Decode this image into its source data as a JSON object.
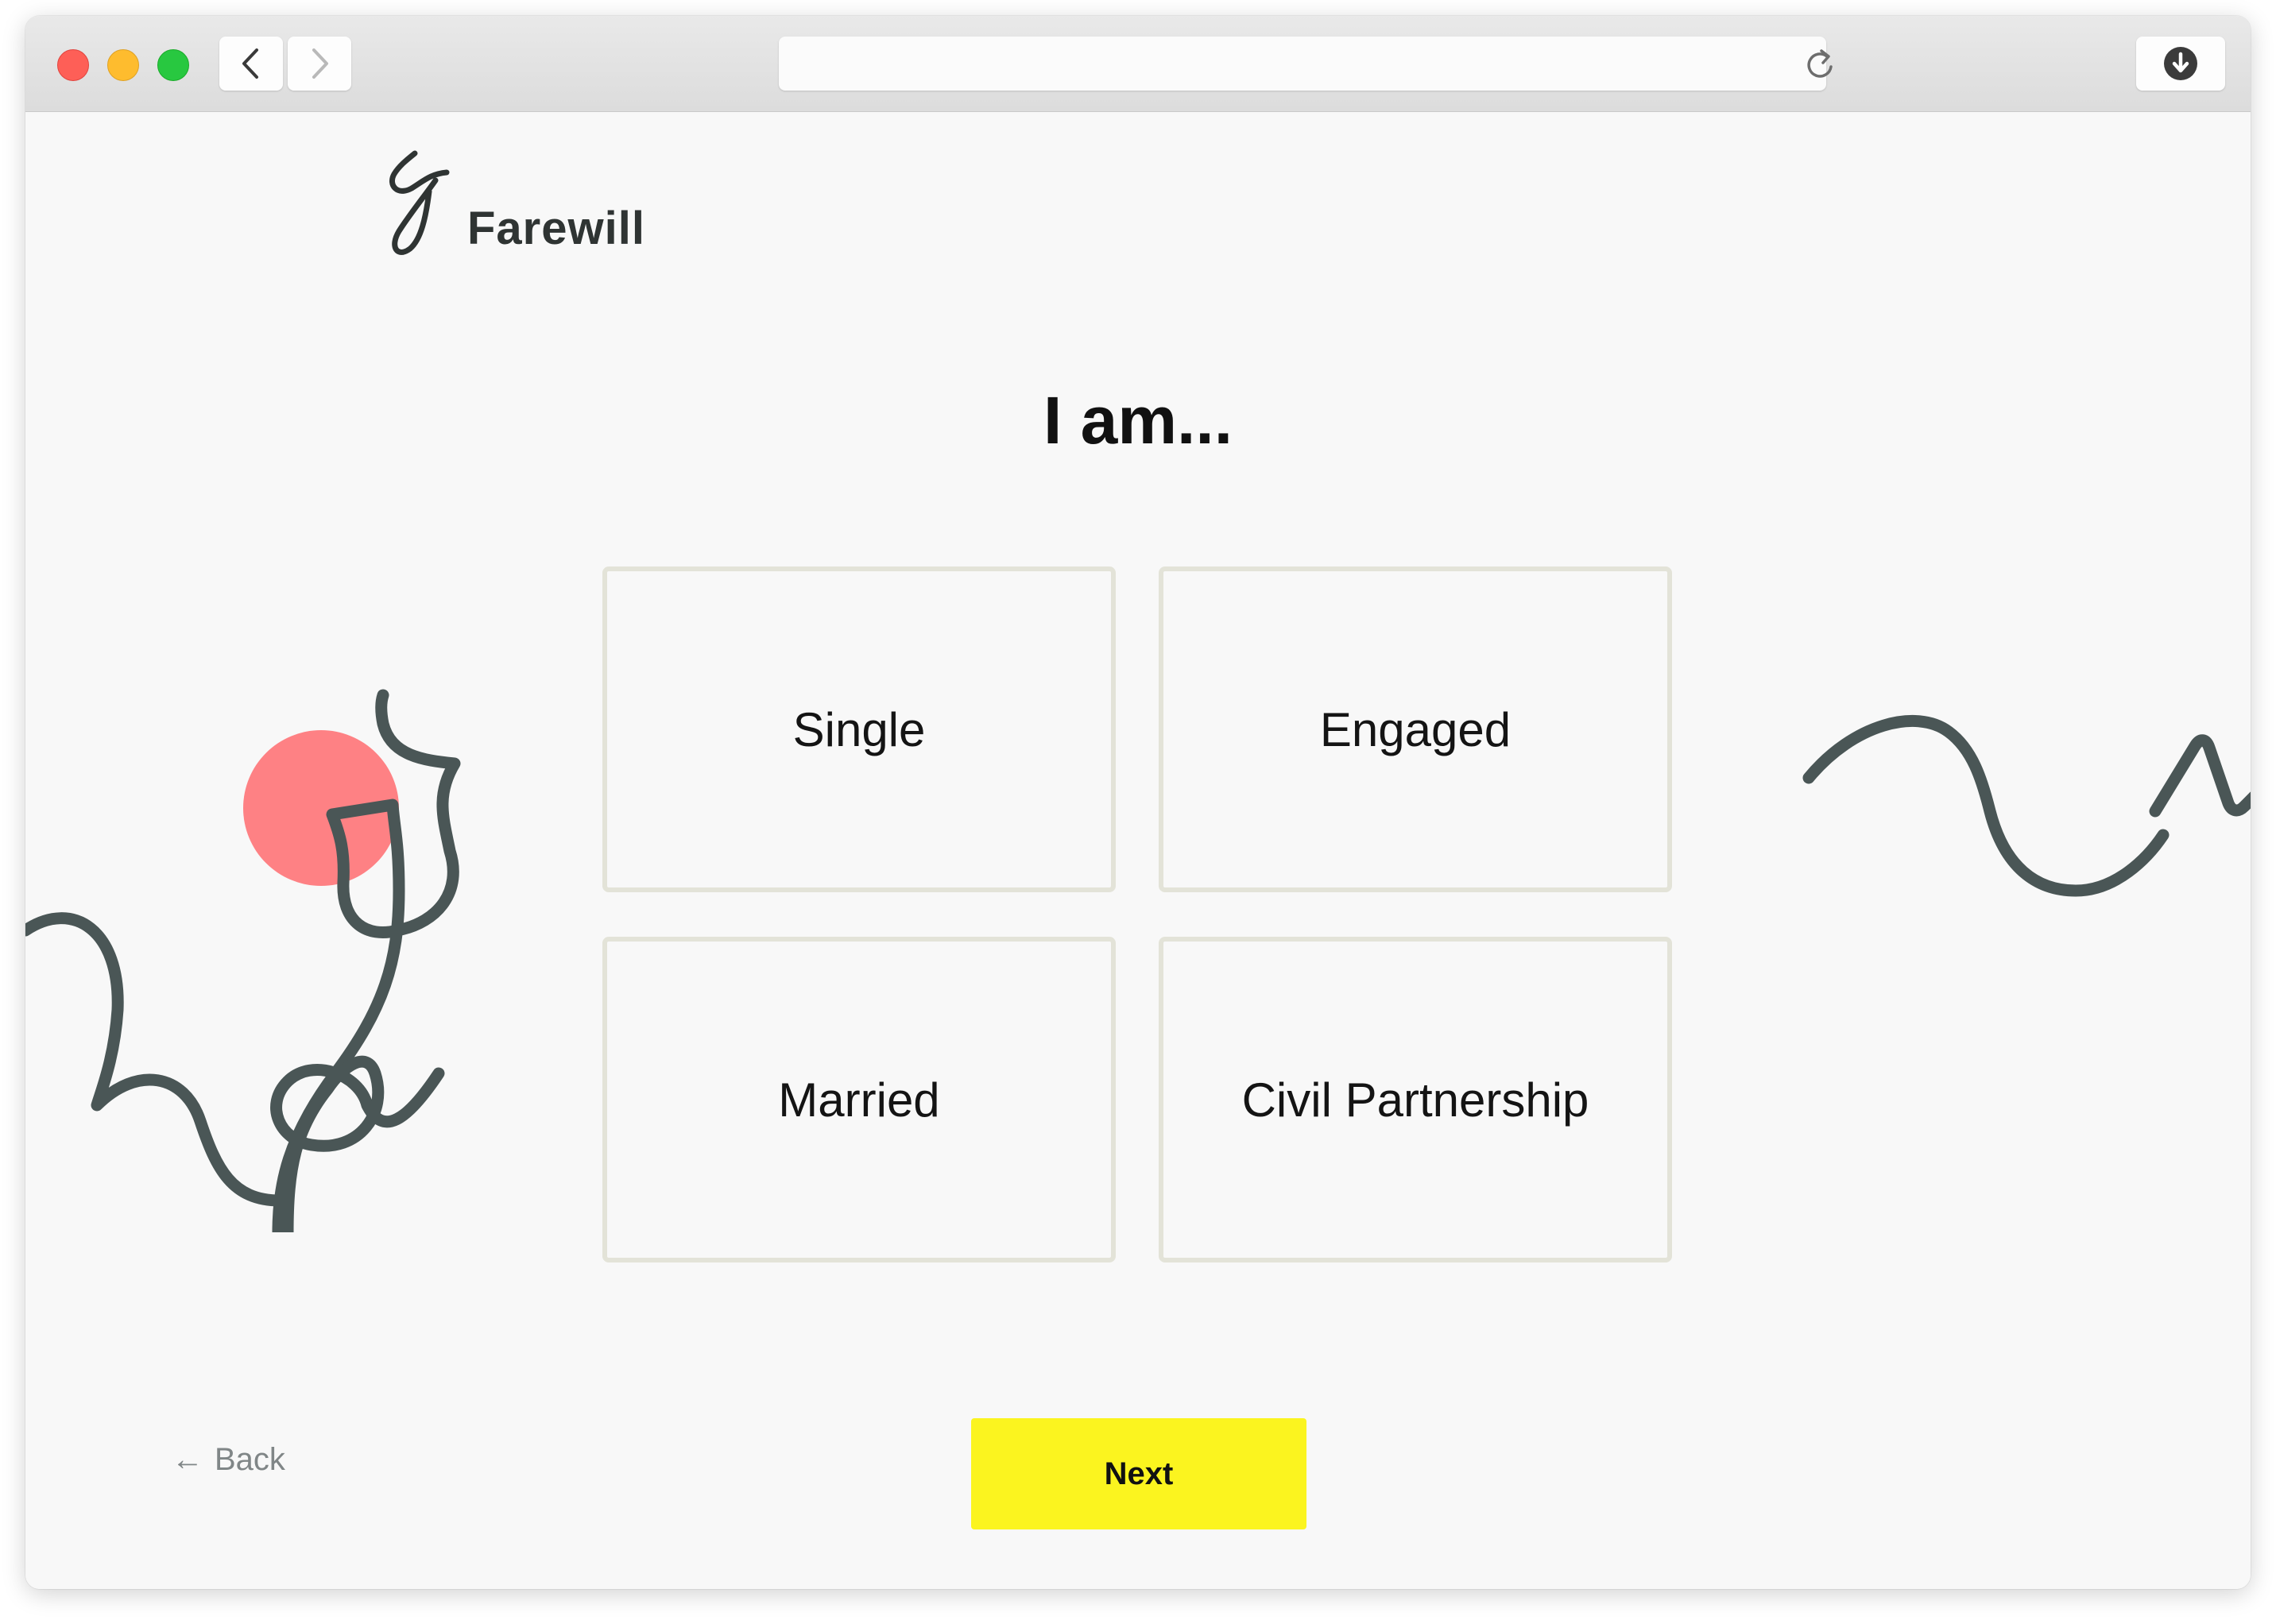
{
  "browser": {
    "address_value": "",
    "icons": {
      "back": "chevron-left-icon",
      "forward": "chevron-right-icon",
      "reload": "reload-icon",
      "download": "download-icon"
    }
  },
  "brand": {
    "name": "Farewill"
  },
  "question": {
    "title": "I am..."
  },
  "options": [
    {
      "label": "Single"
    },
    {
      "label": "Engaged"
    },
    {
      "label": "Married"
    },
    {
      "label": "Civil Partnership"
    }
  ],
  "footer": {
    "back_arrow": "←",
    "back_label": "Back",
    "next_label": "Next"
  },
  "colors": {
    "accent_yellow": "#fbf41f",
    "illustration_pink": "#fe8184",
    "illustration_line": "#4a5656",
    "option_border": "#e3e3d8"
  }
}
